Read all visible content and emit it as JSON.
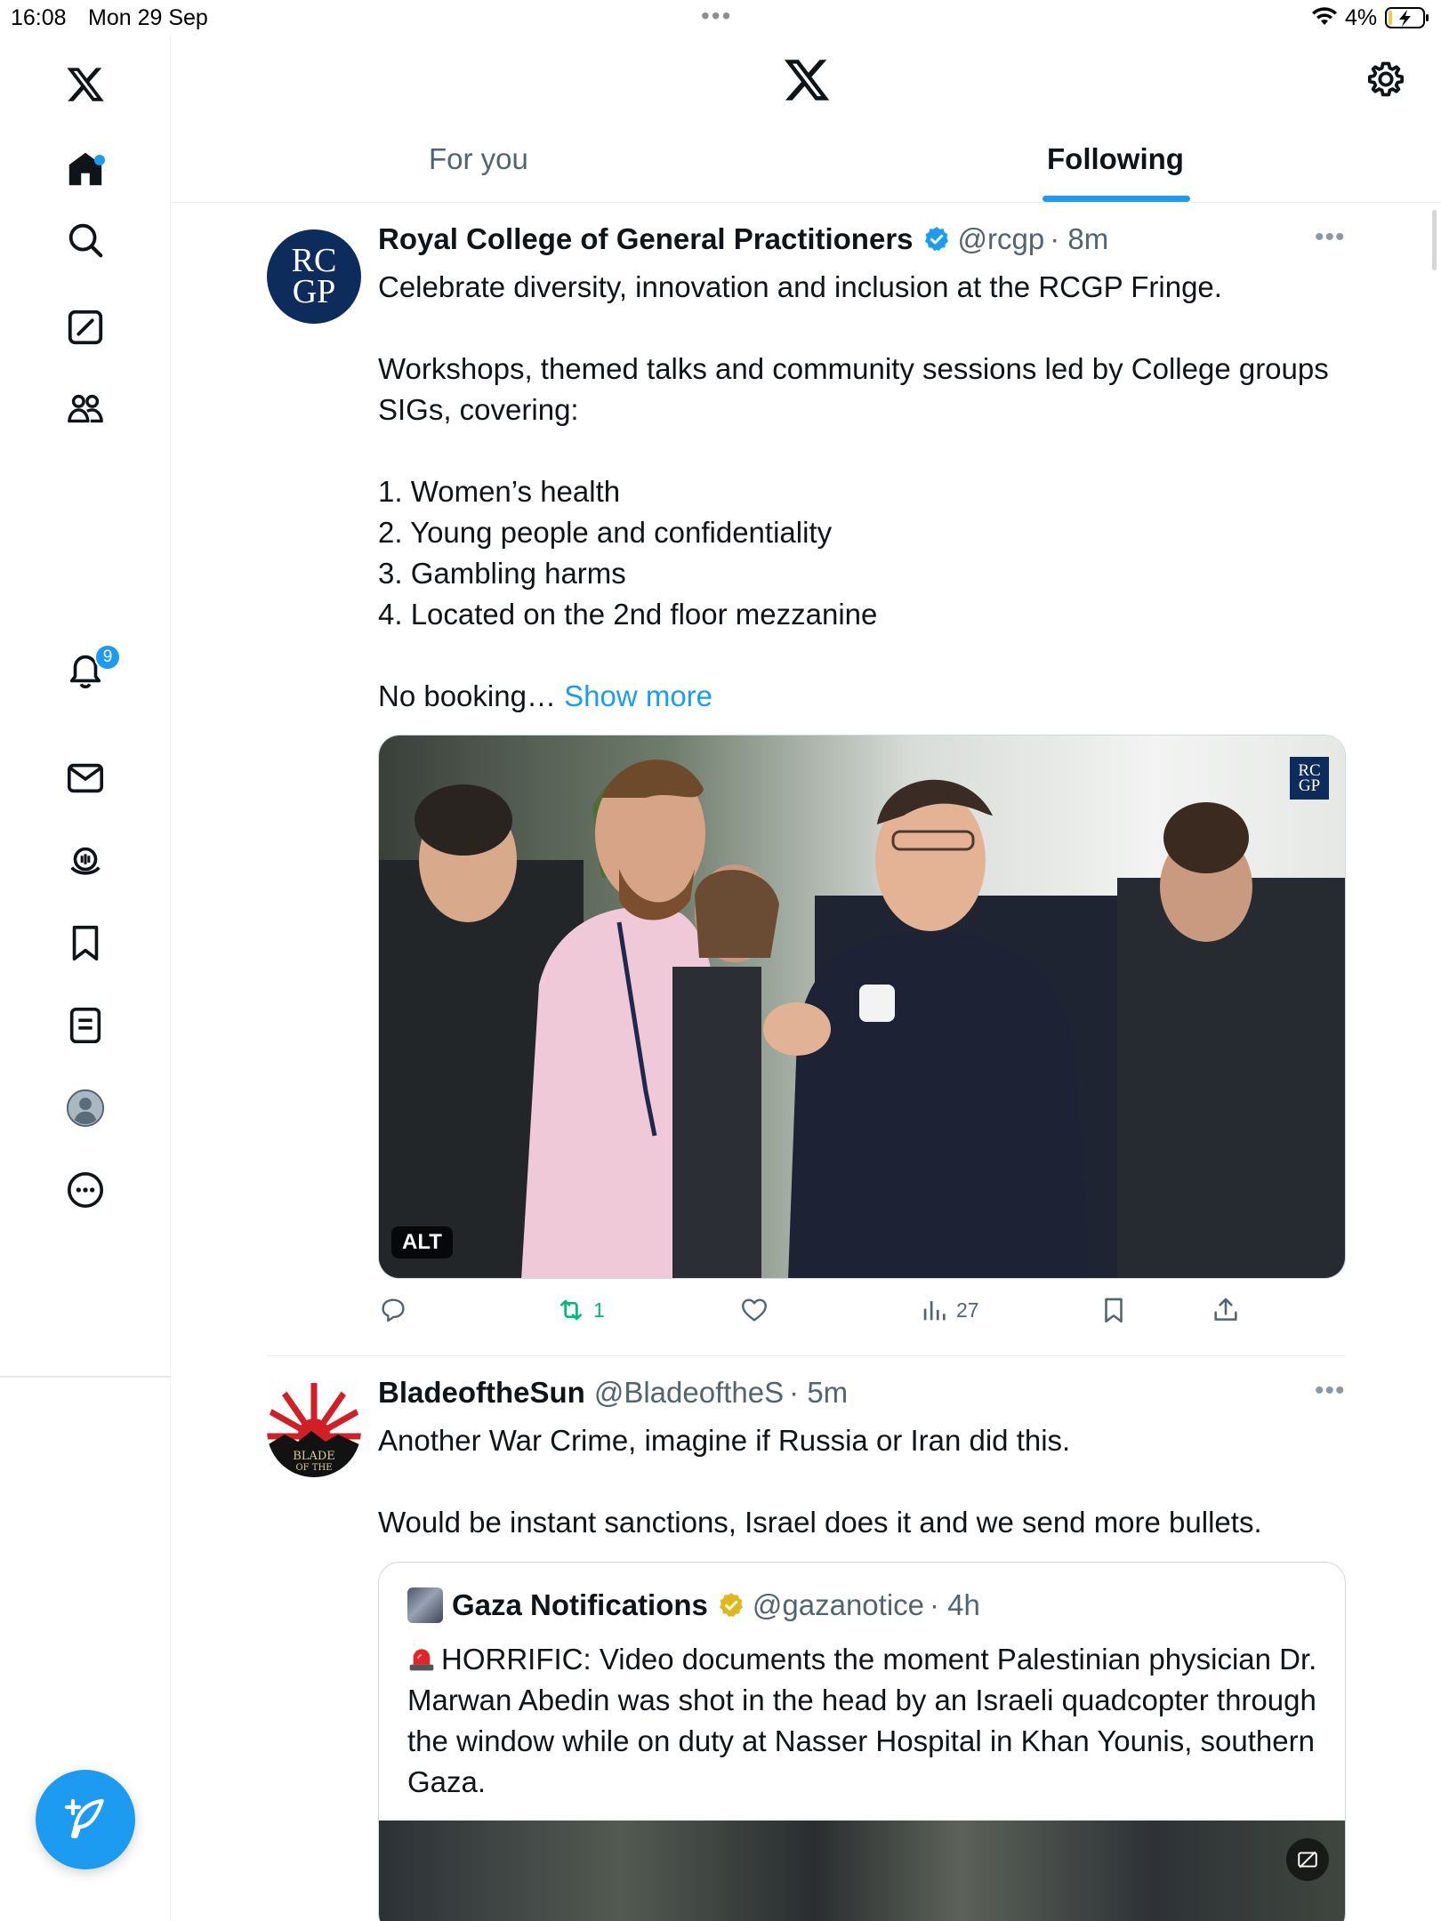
{
  "status_bar": {
    "time": "16:08",
    "date": "Mon 29 Sep",
    "battery": "4%"
  },
  "header": {
    "tabs": [
      {
        "label": "For you"
      },
      {
        "label": "Following"
      }
    ]
  },
  "sidebar": {
    "notifications_count": "9"
  },
  "tweets": [
    {
      "author": "Royal College of General Practitioners",
      "handle": "@rcgp",
      "time": "· 8m",
      "avatar_text": [
        "RC",
        "GP"
      ],
      "text": "Celebrate diversity, innovation and inclusion at the RCGP Fringe.\n\nWorkshops, themed talks and community sessions led by College groups  SIGs, covering:\n\n1. Women’s health\n2. Young people and confidentiality\n3. Gambling harms\n4. Located on the 2nd floor mezzanine\n\nNo booking…",
      "show_more": "Show more",
      "media_alt_label": "ALT",
      "media_logo": [
        "RC",
        "GP"
      ],
      "retweets": "1",
      "views": "27"
    },
    {
      "author": "BladeoftheSun",
      "handle": "@BladeoftheS",
      "time": "· 5m",
      "text": "Another War Crime, imagine if Russia or Iran did this.\n\nWould be instant sanctions, Israel does it and we send more bullets.",
      "quote": {
        "author": "Gaza Notifications",
        "handle": "@gazanotice",
        "time": "· 4h",
        "text": "HORRIFIC: Video documents the moment Palestinian physician Dr. Marwan Abedin was shot in the head by an Israeli quadcopter through the window while on duty at Nasser Hospital in Khan Younis, southern Gaza."
      }
    }
  ],
  "colors": {
    "accent": "#1d9bf0",
    "retweet": "#00ba7c",
    "brand_navy": "#0d2c5c",
    "verified_gold": "#e2b719"
  }
}
